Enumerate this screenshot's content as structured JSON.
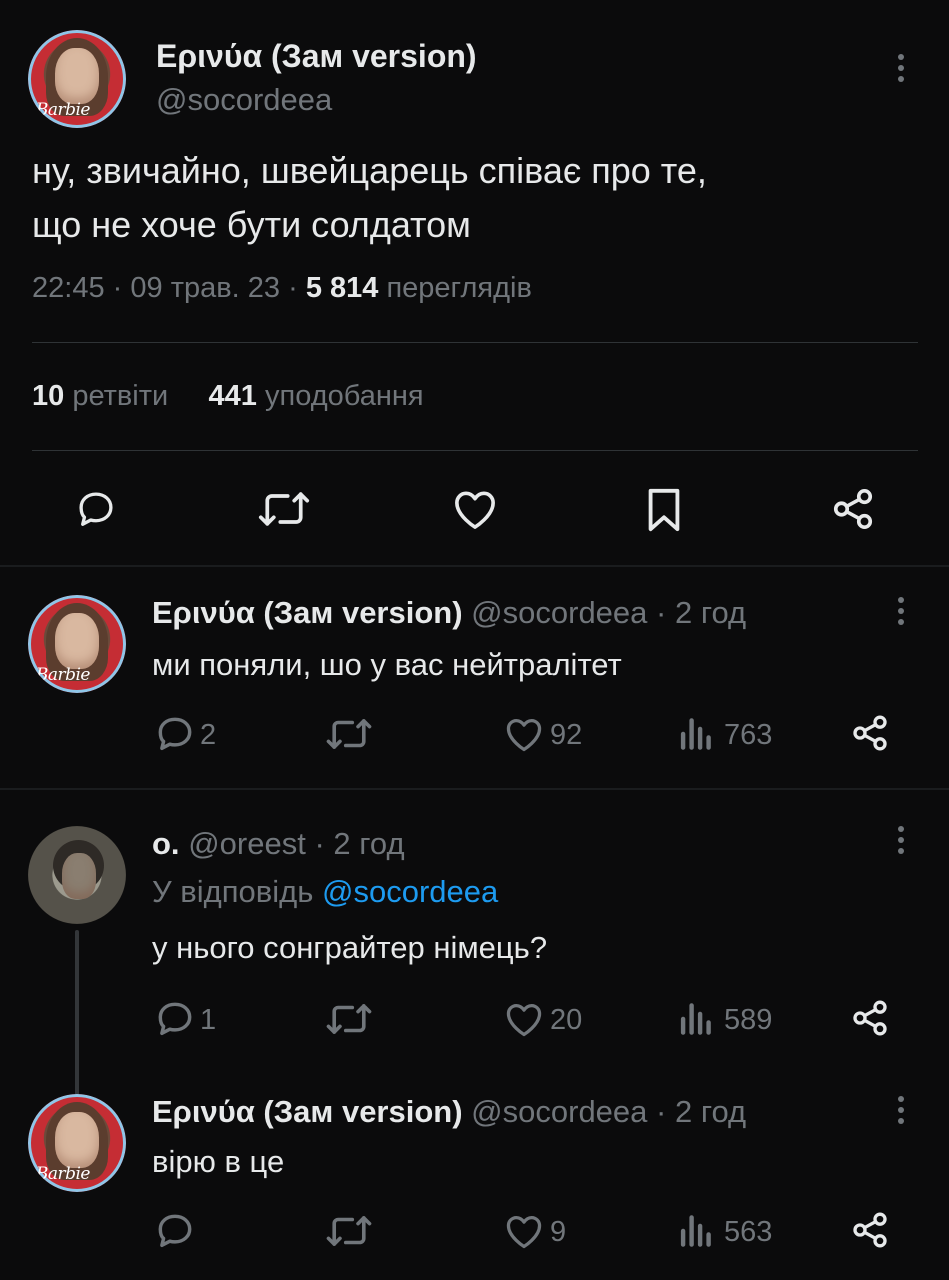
{
  "main_tweet": {
    "display_name": "Ερινύα (Зам version)",
    "handle": "@socordeea",
    "avatar_text": "Barbie",
    "text_line1": "ну, звичайно, швейцарець співає про те,",
    "text_line2": "що не хоче бути солдатом",
    "time": "22:45",
    "date": "09 трав. 23",
    "views_count": "5 814",
    "views_label": "переглядів",
    "retweets_count": "10",
    "retweets_label": "ретвіти",
    "likes_count": "441",
    "likes_label": "уподобання",
    "actions": [
      "reply-icon",
      "retweet-icon",
      "like-icon",
      "bookmark-icon",
      "share-icon"
    ]
  },
  "replies": [
    {
      "display_name": "Ερινύα (Зам version)",
      "handle": "@socordeea",
      "time": "2 год",
      "avatar_text": "Barbie",
      "text": "ми поняли, шо у вас нейтралітет",
      "reply_count": "2",
      "like_count": "92",
      "views_count": "763"
    },
    {
      "display_name": "о.",
      "handle": "@oreest",
      "time": "2 год",
      "reply_to_label": "У відповідь",
      "reply_to_mention": "@socordeea",
      "text": "у нього сонграйтер німець?",
      "reply_count": "1",
      "like_count": "20",
      "views_count": "589"
    },
    {
      "display_name": "Ερινύα (Зам version)",
      "handle": "@socordeea",
      "time": "2 год",
      "avatar_text": "Barbie",
      "text": "вірю в це",
      "like_count": "9",
      "views_count": "563"
    }
  ],
  "separator": "·",
  "colors": {
    "background": "#0b0b0c",
    "text": "#e7e9ea",
    "muted": "#71767b",
    "accent": "#1d9bf0",
    "divider": "#2f3336"
  }
}
